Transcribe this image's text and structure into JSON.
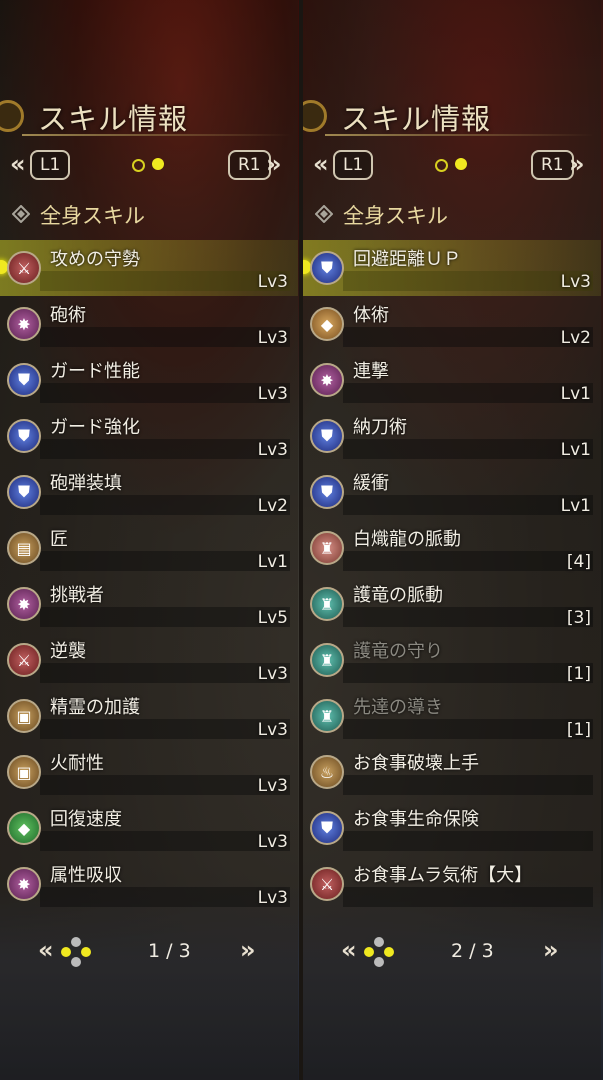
{
  "panels": [
    {
      "title": "スキル情報",
      "left_button": "L1",
      "right_button": "R1",
      "section": "全身スキル",
      "page": "1 / 3",
      "skills": [
        {
          "name": "攻めの守勢",
          "level": "Lv3",
          "icon": "lance-red-icon",
          "selected": true
        },
        {
          "name": "砲術",
          "level": "Lv3",
          "icon": "burst-purple-icon"
        },
        {
          "name": "ガード性能",
          "level": "Lv3",
          "icon": "shield-blue-icon"
        },
        {
          "name": "ガード強化",
          "level": "Lv3",
          "icon": "shield-blue-icon"
        },
        {
          "name": "砲弾装填",
          "level": "Lv2",
          "icon": "shield-blue-icon"
        },
        {
          "name": "匠",
          "level": "Lv1",
          "icon": "scroll-tan-icon"
        },
        {
          "name": "挑戦者",
          "level": "Lv5",
          "icon": "burst-purple-icon"
        },
        {
          "name": "逆襲",
          "level": "Lv3",
          "icon": "lance-red-icon"
        },
        {
          "name": "精霊の加護",
          "level": "Lv3",
          "icon": "crest-tan-icon"
        },
        {
          "name": "火耐性",
          "level": "Lv3",
          "icon": "crest-tan-icon"
        },
        {
          "name": "回復速度",
          "level": "Lv3",
          "icon": "diamond-green-icon"
        },
        {
          "name": "属性吸収",
          "level": "Lv3",
          "icon": "burst-purple-icon"
        }
      ]
    },
    {
      "title": "スキル情報",
      "left_button": "L1",
      "right_button": "R1",
      "section": "全身スキル",
      "page": "2 / 3",
      "skills": [
        {
          "name": "回避距離ＵＰ",
          "level": "Lv3",
          "icon": "shield-blue-icon",
          "selected": true
        },
        {
          "name": "体術",
          "level": "Lv2",
          "icon": "diamond-orange-icon"
        },
        {
          "name": "連撃",
          "level": "Lv1",
          "icon": "burst-purple-icon"
        },
        {
          "name": "納刀術",
          "level": "Lv1",
          "icon": "shield-blue-icon"
        },
        {
          "name": "緩衝",
          "level": "Lv1",
          "icon": "shield-blue-icon"
        },
        {
          "name": "白熾龍の脈動",
          "level": "[4]",
          "icon": "dragon-pink-icon"
        },
        {
          "name": "護竜の脈動",
          "level": "[3]",
          "icon": "dragon-teal-icon"
        },
        {
          "name": "護竜の守り",
          "level": "[1]",
          "icon": "dragon-teal-icon",
          "dim": true
        },
        {
          "name": "先達の導き",
          "level": "[1]",
          "icon": "dragon-teal-icon",
          "dim": true
        },
        {
          "name": "お食事破壊上手",
          "level": "",
          "icon": "food-tan-icon"
        },
        {
          "name": "お食事生命保険",
          "level": "",
          "icon": "shield-blue-icon"
        },
        {
          "name": "お食事ムラ気術【大】",
          "level": "",
          "icon": "lance-red-icon"
        }
      ]
    }
  ]
}
